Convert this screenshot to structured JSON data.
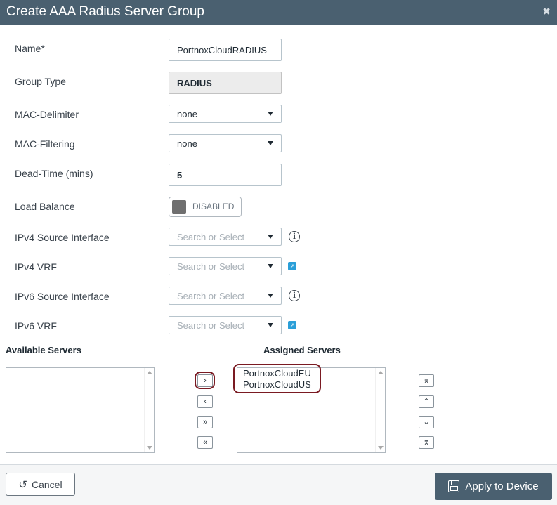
{
  "dialog": {
    "title": "Create AAA Radius Server Group",
    "close_icon": "close-icon"
  },
  "form": {
    "name_label": "Name*",
    "name_value": "PortnoxCloudRADIUS",
    "group_type_label": "Group Type",
    "group_type_value": "RADIUS",
    "mac_delimiter_label": "MAC-Delimiter",
    "mac_delimiter_value": "none",
    "mac_filtering_label": "MAC-Filtering",
    "mac_filtering_value": "none",
    "dead_time_label": "Dead-Time (mins)",
    "dead_time_value": "5",
    "load_balance_label": "Load Balance",
    "load_balance_state": "DISABLED",
    "ipv4_source_label": "IPv4 Source Interface",
    "ipv4_source_placeholder": "Search or Select",
    "ipv4_vrf_label": "IPv4 VRF",
    "ipv4_vrf_placeholder": "Search or Select",
    "ipv6_source_label": "IPv6 Source Interface",
    "ipv6_source_placeholder": "Search or Select",
    "ipv6_vrf_label": "IPv6 VRF",
    "ipv6_vrf_placeholder": "Search or Select"
  },
  "servers": {
    "available_label": "Available Servers",
    "assigned_label": "Assigned Servers",
    "available": [],
    "assigned": [
      "PortnoxCloudEU",
      "PortnoxCloudUS"
    ],
    "move_right": "›",
    "move_left": "‹",
    "move_all_right": "»",
    "move_all_left": "«",
    "order_top": "⌅",
    "order_up": "⌃",
    "order_down": "⌄",
    "order_bottom": "⌆"
  },
  "footer": {
    "cancel_label": "Cancel",
    "apply_label": "Apply to Device"
  },
  "colors": {
    "header": "#4a6070",
    "highlight": "#7a1a22",
    "link_icon": "#2b9fd8"
  }
}
